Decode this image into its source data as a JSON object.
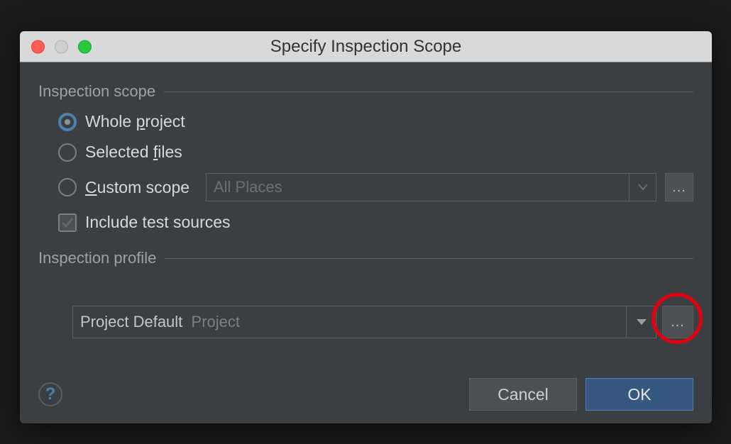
{
  "dialog": {
    "title": "Specify Inspection Scope",
    "sections": {
      "scope": {
        "title": "Inspection scope",
        "options": {
          "whole_project_pre": "Whole ",
          "whole_project_m": "p",
          "whole_project_post": "roject",
          "selected_files_pre": "Selected ",
          "selected_files_m": "f",
          "selected_files_post": "iles",
          "custom_scope_m": "C",
          "custom_scope_post": "ustom scope",
          "custom_scope_value": "All Places",
          "include_test_pre": "Include test sources"
        }
      },
      "profile": {
        "title": "Inspection profile",
        "value_primary": "Project Default",
        "value_secondary": "Project"
      }
    },
    "buttons": {
      "help": "?",
      "cancel": "Cancel",
      "ok": "OK",
      "ellipsis": "..."
    }
  }
}
